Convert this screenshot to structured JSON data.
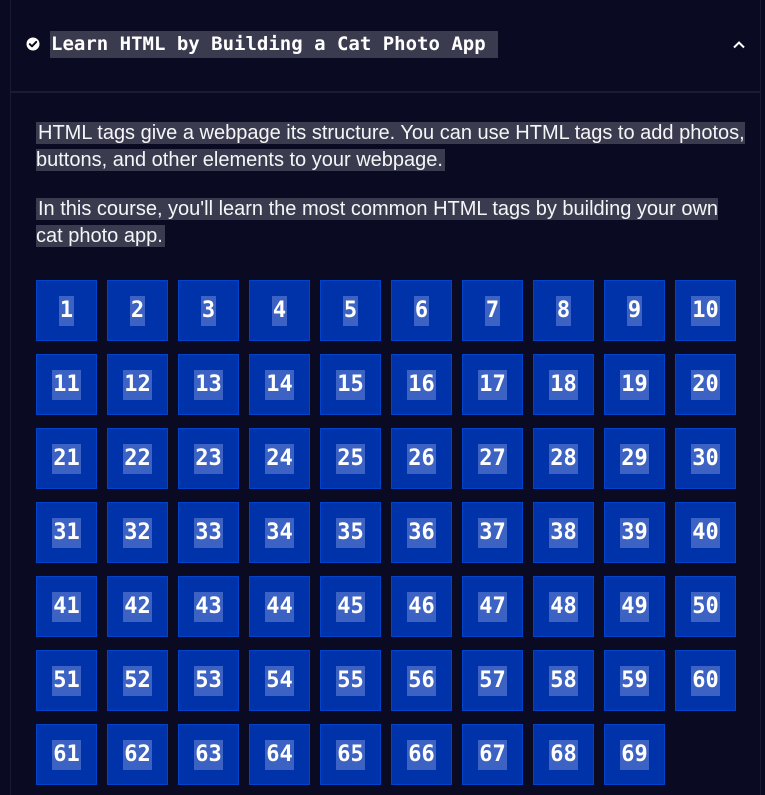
{
  "block": {
    "title": "Learn HTML by Building a Cat Photo App",
    "intro": [
      "HTML tags give a webpage its structure. You can use HTML tags to add photos, buttons, and other elements to your webpage.",
      "In this course, you'll learn the most common HTML tags by building your own cat photo app."
    ],
    "status_icon": "check-circle-icon",
    "toggle_icon": "chevron-up-icon"
  },
  "steps": [
    "1",
    "2",
    "3",
    "4",
    "5",
    "6",
    "7",
    "8",
    "9",
    "10",
    "11",
    "12",
    "13",
    "14",
    "15",
    "16",
    "17",
    "18",
    "19",
    "20",
    "21",
    "22",
    "23",
    "24",
    "25",
    "26",
    "27",
    "28",
    "29",
    "30",
    "31",
    "32",
    "33",
    "34",
    "35",
    "36",
    "37",
    "38",
    "39",
    "40",
    "41",
    "42",
    "43",
    "44",
    "45",
    "46",
    "47",
    "48",
    "49",
    "50",
    "51",
    "52",
    "53",
    "54",
    "55",
    "56",
    "57",
    "58",
    "59",
    "60",
    "61",
    "62",
    "63",
    "64",
    "65",
    "66",
    "67",
    "68",
    "69"
  ],
  "colors": {
    "background": "#0a0a23",
    "highlight": "#3b3b4f",
    "step_bg": "#0033aa",
    "step_label_bg": "#3c63c4",
    "text": "#ffffff"
  }
}
